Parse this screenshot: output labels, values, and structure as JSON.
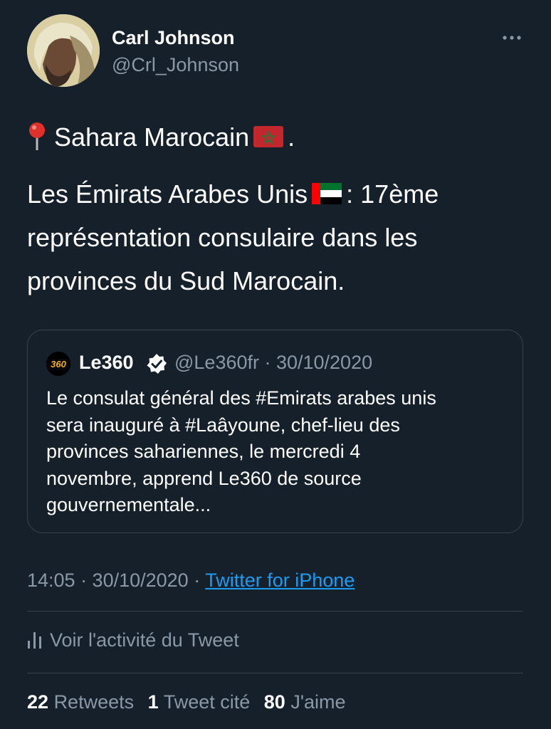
{
  "author": {
    "name": "Carl Johnson",
    "handle": "@Crl_Johnson"
  },
  "tweet": {
    "line1": "Sahara Marocain",
    "line1_suffix": ".",
    "line2a": "Les Émirats Arabes Unis",
    "line2b": ": 17ème",
    "line3": "représentation consulaire dans les",
    "line4": "provinces du Sud Marocain."
  },
  "quoted": {
    "logo_text": "360",
    "name": "Le360",
    "handle_date": "@Le360fr · 30/10/2020",
    "lines": [
      "Le consulat général des #Emirats arabes unis",
      "sera inauguré à #Laâyoune, chef-lieu des",
      "provinces sahariennes, le mercredi 4",
      "novembre, apprend Le360 de source",
      "gouvernementale..."
    ]
  },
  "meta": {
    "time_date": "14:05 · 30/10/2020 · ",
    "source": "Twitter for iPhone"
  },
  "activity": {
    "label": "Voir l'activité du Tweet"
  },
  "stats": {
    "retweets_count": "22",
    "retweets_label": "Retweets",
    "quotes_count": "1",
    "quotes_label": "Tweet cité",
    "likes_count": "80",
    "likes_label": "J'aime"
  },
  "icons": [
    "avatar",
    "more-icon",
    "pin-icon",
    "morocco-flag-icon",
    "uae-flag-icon",
    "le360-logo",
    "verified-badge-icon",
    "activity-chart-icon"
  ],
  "colors": {
    "background": "#15202b",
    "secondary_text": "#8b98a5",
    "link": "#1d9bf0",
    "border": "#38444d"
  }
}
